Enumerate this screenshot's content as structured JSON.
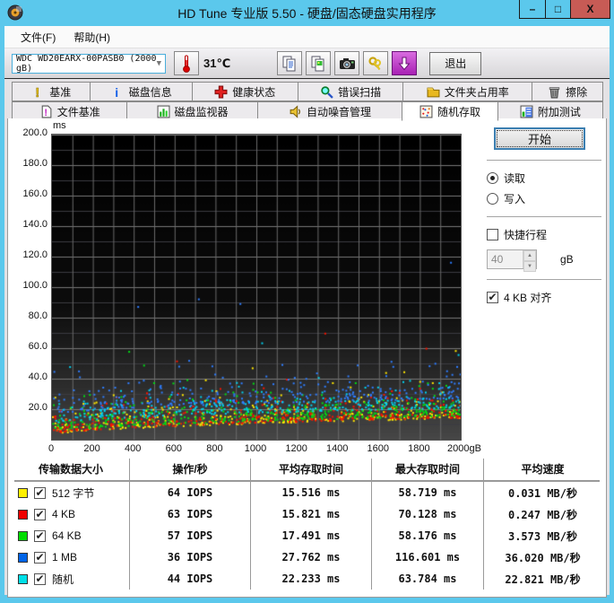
{
  "window": {
    "title": "HD Tune 专业版 5.50 - 硬盘/固态硬盘实用程序",
    "minimize": "–",
    "maximize": "□",
    "close": "X"
  },
  "menu": {
    "file": "文件(F)",
    "help": "帮助(H)"
  },
  "toolbar": {
    "drive": "WDC WD20EARX-00PASB0 (2000 gB)",
    "temperature": "31℃",
    "exit_label": "退出"
  },
  "tabs": {
    "row1": [
      {
        "label": "基准",
        "icon": "exclamation"
      },
      {
        "label": "磁盘信息",
        "icon": "info"
      },
      {
        "label": "健康状态",
        "icon": "health-cross"
      },
      {
        "label": "错误扫描",
        "icon": "magnifier"
      },
      {
        "label": "文件夹占用率",
        "icon": "folder"
      },
      {
        "label": "擦除",
        "icon": "trash"
      }
    ],
    "row2": [
      {
        "label": "文件基准",
        "icon": "file-bench"
      },
      {
        "label": "磁盘监视器",
        "icon": "bar-monitor"
      },
      {
        "label": "自动噪音管理",
        "icon": "speaker"
      },
      {
        "label": "随机存取",
        "icon": "scatter",
        "active": true
      },
      {
        "label": "附加测试",
        "icon": "extra-chart"
      }
    ]
  },
  "controls": {
    "start_label": "开始",
    "read_label": "读取",
    "read_selected": true,
    "write_label": "写入",
    "write_selected": false,
    "shortstroke_label": "快捷行程",
    "shortstroke_checked": false,
    "shortstroke_value": "40",
    "shortstroke_unit": "gB",
    "align_label": "4 KB 对齐",
    "align_checked": true
  },
  "chart_data": {
    "type": "scatter",
    "title": "随机存取 access time vs disk position",
    "xlabel": "gB",
    "ylabel": "ms",
    "xlim": [
      0,
      2000
    ],
    "ylim": [
      0,
      200
    ],
    "x_tick_step": 200,
    "x_grid_step": 100,
    "y_tick_step": 20,
    "y_minor_step": 10,
    "x_tick_labels": [
      "0",
      "200",
      "400",
      "600",
      "800",
      "1000",
      "1200",
      "1400",
      "1600",
      "1800",
      "2000gB"
    ],
    "y_tick_labels": [
      "200.0",
      "180.0",
      "160.0",
      "140.0",
      "120.0",
      "100.0",
      "80.0",
      "60.0",
      "40.0",
      "20.0"
    ],
    "unit_label": "ms",
    "envelope": {
      "base_ms": 3.5,
      "rise_ms": 11,
      "power": 0.55
    },
    "series": [
      {
        "name": "512 字节",
        "color": "#FFE800",
        "count": 380,
        "offset": 0,
        "spread": 5,
        "cap": 26,
        "avg_ms": 15.516,
        "max_ms": 58.719,
        "outliers": 6
      },
      {
        "name": "4 KB",
        "color": "#F81400",
        "count": 380,
        "offset": 0.4,
        "spread": 5,
        "cap": 26,
        "avg_ms": 15.821,
        "max_ms": 70.128,
        "outliers": 6
      },
      {
        "name": "64 KB",
        "color": "#00DC14",
        "count": 380,
        "offset": 1.6,
        "spread": 5.5,
        "cap": 28,
        "avg_ms": 17.491,
        "max_ms": 58.176,
        "outliers": 6
      },
      {
        "name": "1 MB",
        "color": "#2E7DFF",
        "count": 300,
        "offset": 13,
        "spread": 6,
        "cap": 30,
        "avg_ms": 27.762,
        "max_ms": 116.601,
        "outliers": 7
      },
      {
        "name": "随机",
        "color": "#00D2F0",
        "count": 300,
        "offset": 7,
        "spread": 4.5,
        "cap": 24,
        "avg_ms": 22.233,
        "max_ms": 63.784,
        "outliers": 7
      }
    ]
  },
  "stats_table": {
    "headers": [
      "传输数据大小",
      "操作/秒",
      "平均存取时间",
      "最大存取时间",
      "平均速度"
    ],
    "rows": [
      {
        "swatch": "#FFF000",
        "checked": true,
        "label": "512 字节",
        "iops": "64 IOPS",
        "avg": "15.516 ms",
        "max": "58.719 ms",
        "speed": "0.031 MB/秒"
      },
      {
        "swatch": "#F00000",
        "checked": true,
        "label": "4 KB",
        "iops": "63 IOPS",
        "avg": "15.821 ms",
        "max": "70.128 ms",
        "speed": "0.247 MB/秒"
      },
      {
        "swatch": "#00DC00",
        "checked": true,
        "label": "64 KB",
        "iops": "57 IOPS",
        "avg": "17.491 ms",
        "max": "58.176 ms",
        "speed": "3.573 MB/秒"
      },
      {
        "swatch": "#0064E8",
        "checked": true,
        "label": "1 MB",
        "iops": "36 IOPS",
        "avg": "27.762 ms",
        "max": "116.601 ms",
        "speed": "36.020 MB/秒"
      },
      {
        "swatch": "#00E0E8",
        "checked": true,
        "label": "随机",
        "iops": "44 IOPS",
        "avg": "22.233 ms",
        "max": "63.784 ms",
        "speed": "22.821 MB/秒"
      }
    ]
  }
}
